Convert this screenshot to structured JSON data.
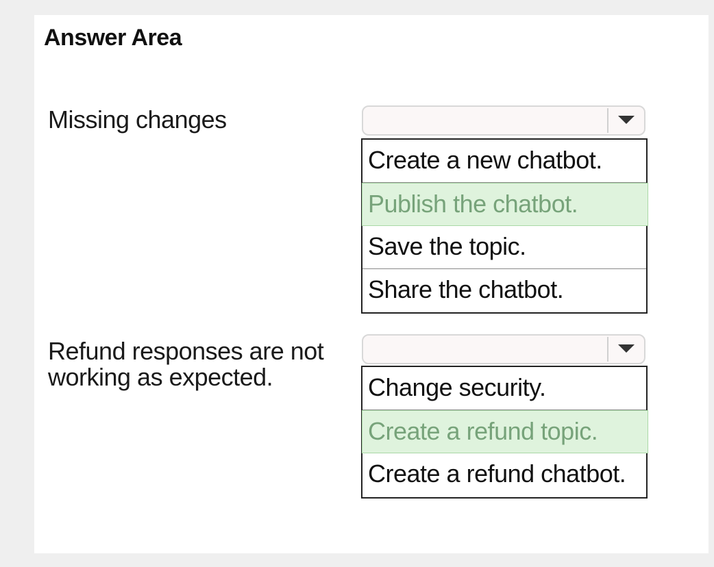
{
  "answer_area": {
    "title": "Answer Area"
  },
  "questions": [
    {
      "label": "Missing changes",
      "selected_value": "",
      "options": [
        {
          "label": "Create a new chatbot.",
          "selected": false
        },
        {
          "label": "Publish the chatbot.",
          "selected": true
        },
        {
          "label": "Save the topic.",
          "selected": false
        },
        {
          "label": "Share the chatbot.",
          "selected": false
        }
      ]
    },
    {
      "label": "Refund responses are not working as expected.",
      "selected_value": "",
      "options": [
        {
          "label": "Change security.",
          "selected": false
        },
        {
          "label": "Create a refund topic.",
          "selected": true
        },
        {
          "label": "Create a refund chatbot.",
          "selected": false
        }
      ]
    }
  ],
  "colors": {
    "selected_bg": "#dff3dd",
    "selected_text": "#77a37a",
    "panel_bg": "#ffffff",
    "page_bg": "#efefef"
  },
  "icons": {
    "dropdown": "chevron-down-icon"
  }
}
